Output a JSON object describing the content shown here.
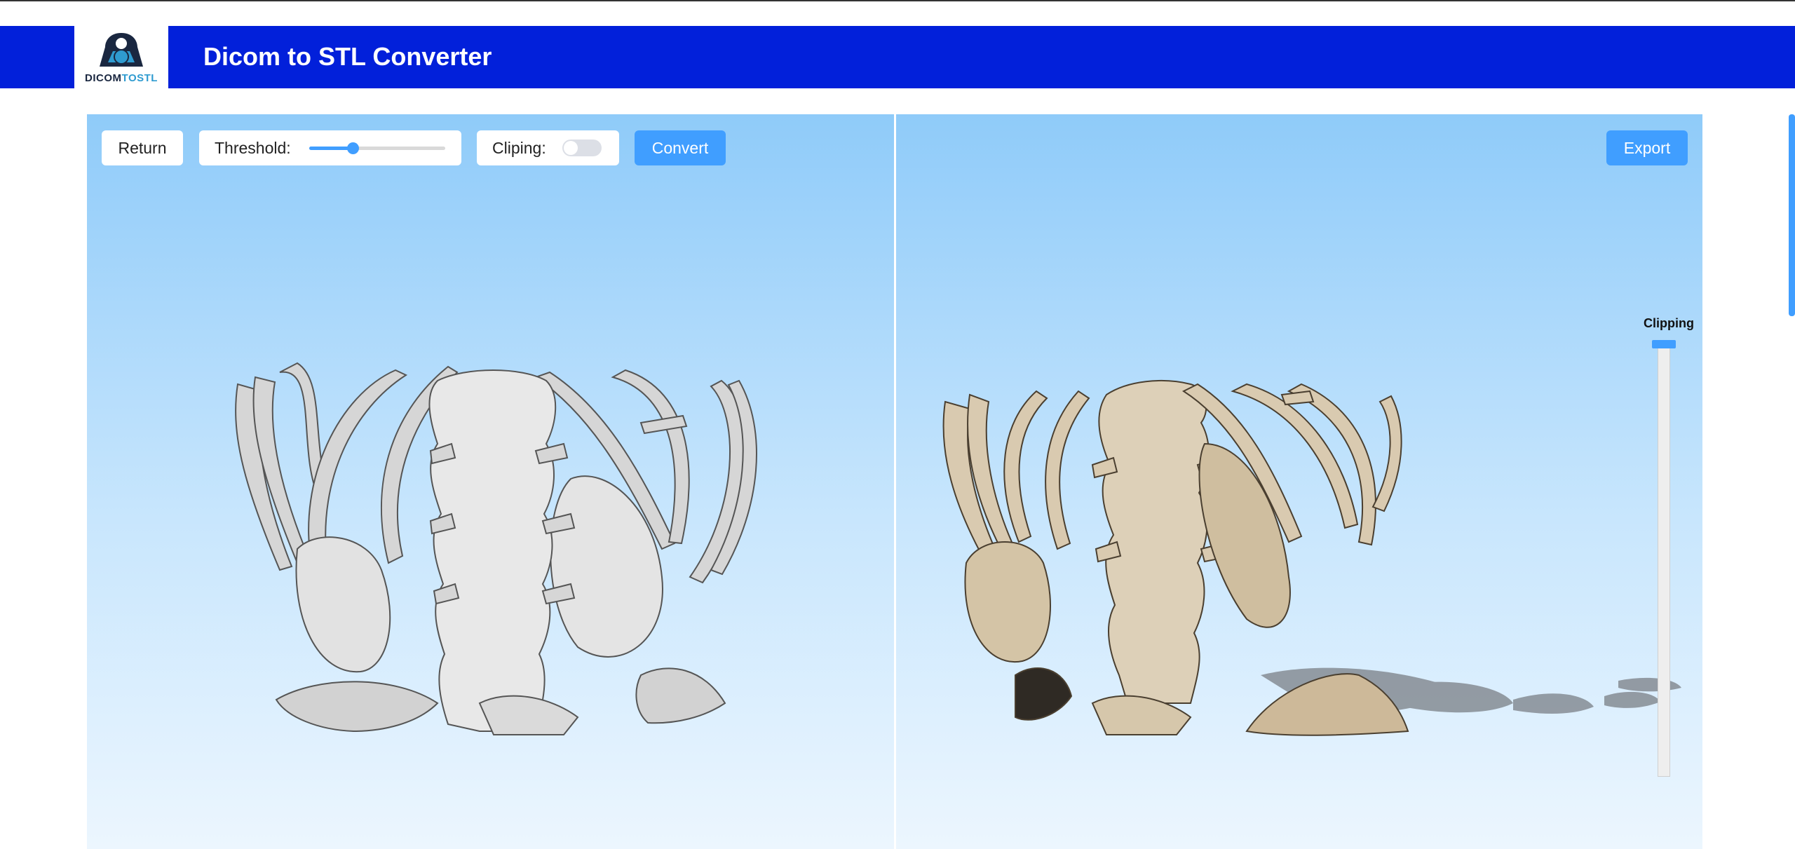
{
  "header": {
    "title": "Dicom to STL Converter",
    "logo_text_dark": "DICOM",
    "logo_text_accent": "TOSTL"
  },
  "toolbar": {
    "return_label": "Return",
    "threshold_label": "Threshold:",
    "threshold_value_fraction": 0.32,
    "clipping_label": "Cliping:",
    "clipping_enabled": false,
    "convert_label": "Convert",
    "export_label": "Export"
  },
  "right_viewer": {
    "clipping_slider_label": "Clipping",
    "clipping_slider_value_fraction": 1.0
  },
  "colors": {
    "header_bg": "#0220da",
    "accent": "#409eff",
    "bone_gray": "#d0d0d0",
    "bone_tan": "#d8c9b0"
  },
  "icons": [
    "logo-icon",
    "slider-knob-icon",
    "toggle-icon"
  ]
}
